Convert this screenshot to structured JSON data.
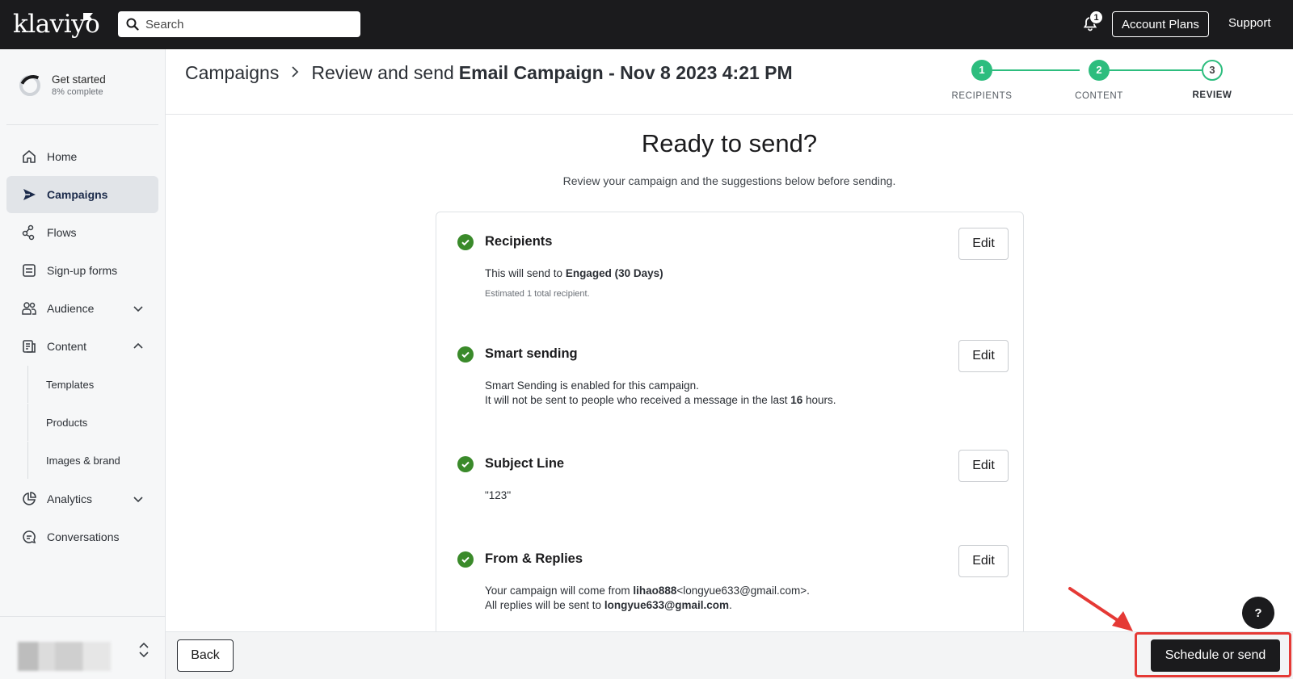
{
  "topbar": {
    "logo": "klaviyo",
    "search_placeholder": "Search",
    "notification_count": "1",
    "account_plans": "Account Plans",
    "support": "Support"
  },
  "sidebar": {
    "get_started_title": "Get started",
    "get_started_sub": "8% complete",
    "items": [
      {
        "label": "Home",
        "icon": "home-icon"
      },
      {
        "label": "Campaigns",
        "icon": "campaigns-icon",
        "active": true
      },
      {
        "label": "Flows",
        "icon": "flows-icon"
      },
      {
        "label": "Sign-up forms",
        "icon": "signup-forms-icon"
      },
      {
        "label": "Audience",
        "icon": "audience-icon",
        "caret": "down"
      },
      {
        "label": "Content",
        "icon": "content-icon",
        "caret": "up"
      },
      {
        "label": "Analytics",
        "icon": "analytics-icon",
        "caret": "down"
      },
      {
        "label": "Conversations",
        "icon": "conversations-icon"
      }
    ],
    "content_subitems": [
      "Templates",
      "Products",
      "Images & brand"
    ]
  },
  "header": {
    "breadcrumb_root": "Campaigns",
    "breadcrumb_step": "Review and send",
    "campaign_name": "Email Campaign - Nov 8 2023 4:21 PM",
    "steps": [
      {
        "number": "1",
        "label": "RECIPIENTS",
        "state": "done"
      },
      {
        "number": "2",
        "label": "CONTENT",
        "state": "done"
      },
      {
        "number": "3",
        "label": "REVIEW",
        "state": "current"
      }
    ]
  },
  "main": {
    "title": "Ready to send?",
    "subtitle": "Review your campaign and the suggestions below before sending.",
    "edit_label": "Edit",
    "sections": {
      "recipients": {
        "title": "Recipients",
        "line1_prefix": "This will send to",
        "line1_bold": "Engaged (30 Days)",
        "estimate": "Estimated 1 total recipient."
      },
      "smart_sending": {
        "title": "Smart sending",
        "line1": "Smart Sending is enabled for this campaign.",
        "line2_prefix": "It will not be sent to people who received a message in the last",
        "line2_bold": "16",
        "line2_suffix": "hours."
      },
      "subject": {
        "title": "Subject Line",
        "value": "\"123\""
      },
      "from": {
        "title": "From & Replies",
        "line1_prefix": "Your campaign will come from",
        "line1_bold": "lihao888",
        "line1_suffix": "<longyue633@gmail.com>.",
        "line2_prefix": "All replies will be sent to",
        "line2_bold": "longyue633@gmail.com",
        "line2_suffix": "."
      }
    }
  },
  "footer": {
    "back_label": "Back",
    "send_label": "Schedule or send",
    "help_label": "?"
  },
  "colors": {
    "topbar": "#1b1b1d",
    "step_green": "#2dbd7e",
    "check_green": "#3a8a2a",
    "highlight_red": "#e53935"
  }
}
